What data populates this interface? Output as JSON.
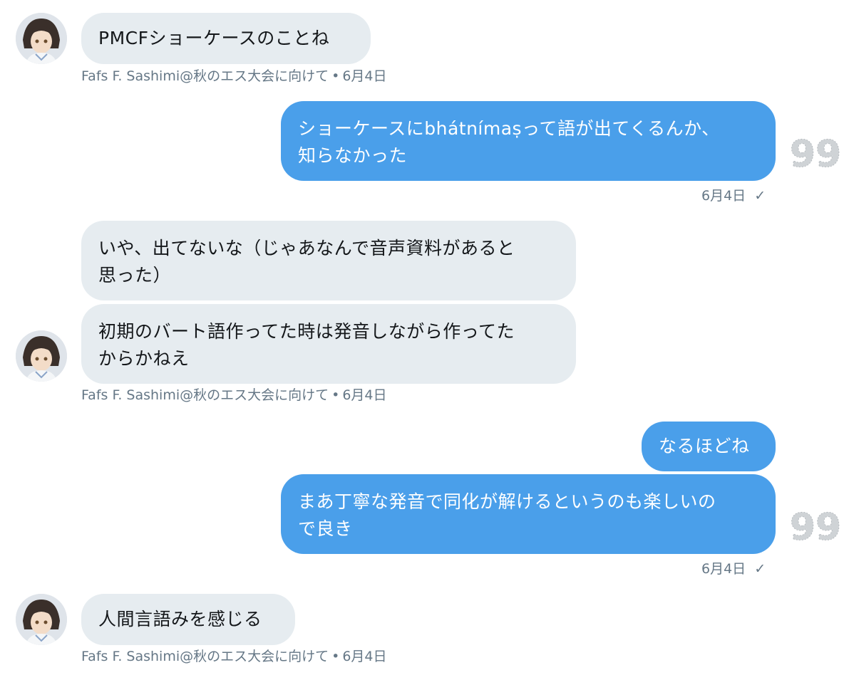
{
  "colors": {
    "incoming_bubble": "#e6ecf0",
    "outgoing_bubble": "#4a9fea",
    "meta_text": "#657786"
  },
  "messages": [
    {
      "direction": "incoming",
      "lines": [
        "PMCFショーケースのことね"
      ],
      "sender": "Fafs F. Sashimi@秋のエス大会に向けて",
      "separator": "•",
      "date": "6月4日"
    },
    {
      "direction": "outgoing",
      "lines": [
        "ショーケースにbhátnímaṣって語が出てくるんか、",
        "知らなかった"
      ],
      "date": "6月4日",
      "status_icon": "check-icon"
    },
    {
      "direction": "incoming",
      "lines": [
        "いや、出てないな（じゃあなんで音声資料があると",
        "思った）"
      ]
    },
    {
      "direction": "incoming",
      "lines": [
        "初期のバート語作ってた時は発音しながら作ってた",
        "からかねえ"
      ],
      "sender": "Fafs F. Sashimi@秋のエス大会に向けて",
      "separator": "•",
      "date": "6月4日"
    },
    {
      "direction": "outgoing",
      "lines": [
        "なるほどね"
      ]
    },
    {
      "direction": "outgoing",
      "lines": [
        "まあ丁寧な発音で同化が解けるというのも楽しいの",
        "で良き"
      ],
      "date": "6月4日",
      "status_icon": "check-icon"
    },
    {
      "direction": "incoming",
      "lines": [
        "人間言語みを感じる"
      ],
      "sender": "Fafs F. Sashimi@秋のエス大会に向けて",
      "separator": "•",
      "date": "6月4日"
    }
  ],
  "icons": {
    "avatar": "avatar",
    "status": "check-icon",
    "side_badge": "quote-99-icon"
  }
}
